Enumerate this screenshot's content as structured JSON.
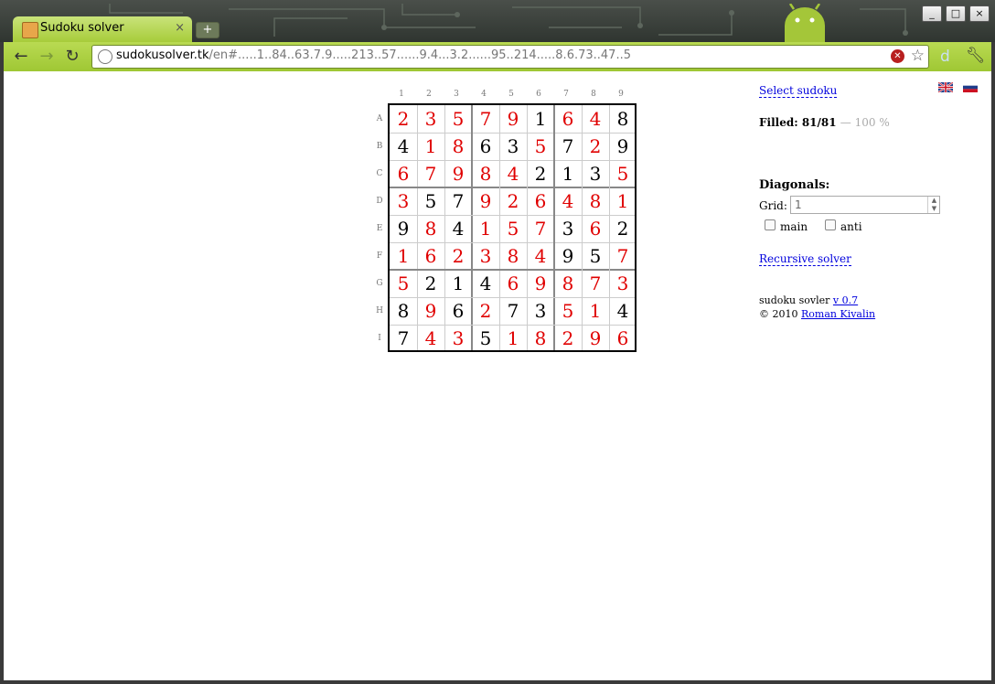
{
  "browser": {
    "tab_title": "Sudoku solver",
    "tab_close": "×",
    "new_tab": "+",
    "url_host": "sudokusolver.tk",
    "url_path": "/en#.....1..84..63.7.9.....213..57......9.4...3.2......95..214.....8.6.73..47..5",
    "window_controls": [
      "_",
      "□",
      "×"
    ],
    "nav": {
      "back": "←",
      "forward": "→",
      "reload": "↻"
    },
    "extension_label": "d"
  },
  "board": {
    "col_labels": [
      "1",
      "2",
      "3",
      "4",
      "5",
      "6",
      "7",
      "8",
      "9"
    ],
    "row_labels": [
      "A",
      "B",
      "C",
      "D",
      "E",
      "F",
      "G",
      "H",
      "I"
    ],
    "rows": [
      [
        {
          "v": "2",
          "g": false
        },
        {
          "v": "3",
          "g": false
        },
        {
          "v": "5",
          "g": false
        },
        {
          "v": "7",
          "g": false
        },
        {
          "v": "9",
          "g": false
        },
        {
          "v": "1",
          "g": true
        },
        {
          "v": "6",
          "g": false
        },
        {
          "v": "4",
          "g": false
        },
        {
          "v": "8",
          "g": true
        }
      ],
      [
        {
          "v": "4",
          "g": true
        },
        {
          "v": "1",
          "g": false
        },
        {
          "v": "8",
          "g": false
        },
        {
          "v": "6",
          "g": true
        },
        {
          "v": "3",
          "g": true
        },
        {
          "v": "5",
          "g": false
        },
        {
          "v": "7",
          "g": true
        },
        {
          "v": "2",
          "g": false
        },
        {
          "v": "9",
          "g": true
        }
      ],
      [
        {
          "v": "6",
          "g": false
        },
        {
          "v": "7",
          "g": false
        },
        {
          "v": "9",
          "g": false
        },
        {
          "v": "8",
          "g": false
        },
        {
          "v": "4",
          "g": false
        },
        {
          "v": "2",
          "g": true
        },
        {
          "v": "1",
          "g": true
        },
        {
          "v": "3",
          "g": true
        },
        {
          "v": "5",
          "g": false
        }
      ],
      [
        {
          "v": "3",
          "g": false
        },
        {
          "v": "5",
          "g": true
        },
        {
          "v": "7",
          "g": true
        },
        {
          "v": "9",
          "g": false
        },
        {
          "v": "2",
          "g": false
        },
        {
          "v": "6",
          "g": false
        },
        {
          "v": "4",
          "g": false
        },
        {
          "v": "8",
          "g": false
        },
        {
          "v": "1",
          "g": false
        }
      ],
      [
        {
          "v": "9",
          "g": true
        },
        {
          "v": "8",
          "g": false
        },
        {
          "v": "4",
          "g": true
        },
        {
          "v": "1",
          "g": false
        },
        {
          "v": "5",
          "g": false
        },
        {
          "v": "7",
          "g": false
        },
        {
          "v": "3",
          "g": true
        },
        {
          "v": "6",
          "g": false
        },
        {
          "v": "2",
          "g": true
        }
      ],
      [
        {
          "v": "1",
          "g": false
        },
        {
          "v": "6",
          "g": false
        },
        {
          "v": "2",
          "g": false
        },
        {
          "v": "3",
          "g": false
        },
        {
          "v": "8",
          "g": false
        },
        {
          "v": "4",
          "g": false
        },
        {
          "v": "9",
          "g": true
        },
        {
          "v": "5",
          "g": true
        },
        {
          "v": "7",
          "g": false
        }
      ],
      [
        {
          "v": "5",
          "g": false
        },
        {
          "v": "2",
          "g": true
        },
        {
          "v": "1",
          "g": true
        },
        {
          "v": "4",
          "g": true
        },
        {
          "v": "6",
          "g": false
        },
        {
          "v": "9",
          "g": false
        },
        {
          "v": "8",
          "g": false
        },
        {
          "v": "7",
          "g": false
        },
        {
          "v": "3",
          "g": false
        }
      ],
      [
        {
          "v": "8",
          "g": true
        },
        {
          "v": "9",
          "g": false
        },
        {
          "v": "6",
          "g": true
        },
        {
          "v": "2",
          "g": false
        },
        {
          "v": "7",
          "g": true
        },
        {
          "v": "3",
          "g": true
        },
        {
          "v": "5",
          "g": false
        },
        {
          "v": "1",
          "g": false
        },
        {
          "v": "4",
          "g": true
        }
      ],
      [
        {
          "v": "7",
          "g": true
        },
        {
          "v": "4",
          "g": false
        },
        {
          "v": "3",
          "g": false
        },
        {
          "v": "5",
          "g": true
        },
        {
          "v": "1",
          "g": false
        },
        {
          "v": "8",
          "g": false
        },
        {
          "v": "2",
          "g": false
        },
        {
          "v": "9",
          "g": false
        },
        {
          "v": "6",
          "g": false
        }
      ]
    ]
  },
  "side": {
    "select_sudoku": "Select sudoku",
    "filled_label": "Filled: 81/81",
    "filled_pct": "— 100 %",
    "diagonals_heading": "Diagonals:",
    "grid_label": "Grid:",
    "grid_value": "1",
    "main_label": "main",
    "anti_label": "anti",
    "recursive_solver": "Recursive solver",
    "footer_text": "sudoku sovler",
    "version_link": "v 0.7",
    "copyright": "© 2010",
    "author_link": "Roman Kivalin"
  },
  "colors": {
    "solved": "#e00000",
    "given": "#000000",
    "link": "#0000dd",
    "toolbar": "#a7cc3a"
  }
}
